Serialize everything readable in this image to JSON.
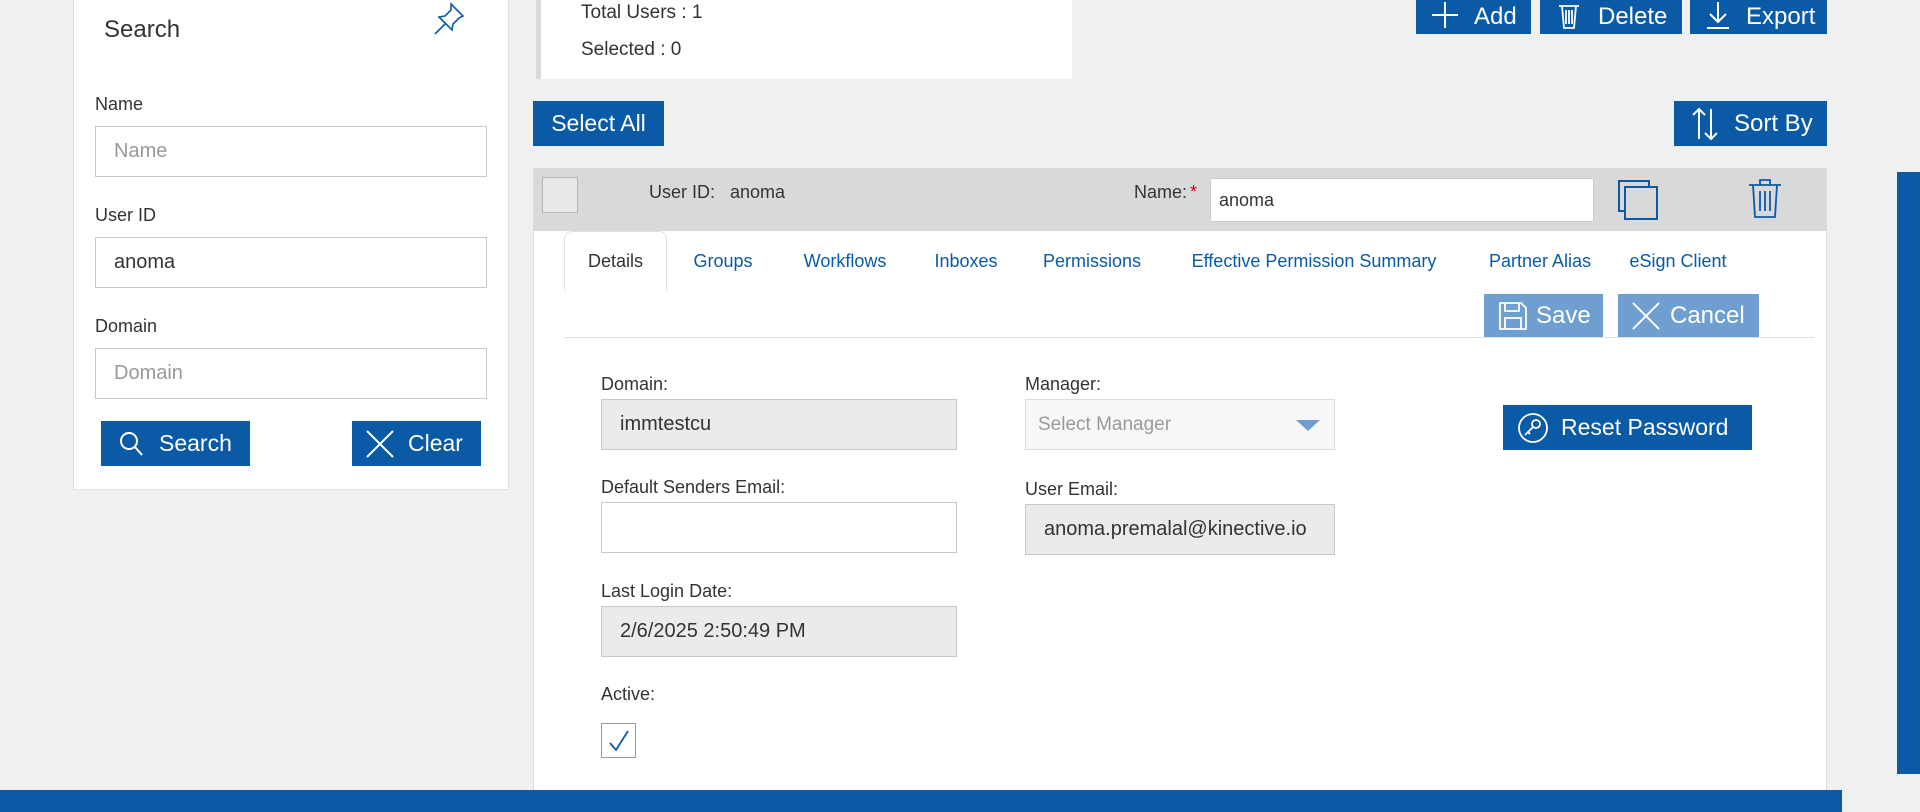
{
  "search_panel": {
    "title": "Search",
    "name_label": "Name",
    "name_placeholder": "Name",
    "name_value": "",
    "userid_label": "User ID",
    "userid_value": "anoma",
    "domain_label": "Domain",
    "domain_placeholder": "Domain",
    "domain_value": "",
    "search_button": "Search",
    "clear_button": "Clear"
  },
  "summary": {
    "total_users": "Total Users : 1",
    "selected": "Selected : 0"
  },
  "toolbar": {
    "add": "Add",
    "delete": "Delete",
    "export": "Export",
    "select_all": "Select All",
    "sort_by": "Sort By"
  },
  "user_row": {
    "userid_label": "User ID:",
    "userid_value": "anoma",
    "name_label": "Name:",
    "required_mark": "*",
    "name_value": "anoma"
  },
  "tabs": [
    {
      "label": "Details"
    },
    {
      "label": "Groups"
    },
    {
      "label": "Workflows"
    },
    {
      "label": "Inboxes"
    },
    {
      "label": "Permissions"
    },
    {
      "label": "Effective Permission Summary"
    },
    {
      "label": "Partner Alias"
    },
    {
      "label": "eSign Client"
    }
  ],
  "details": {
    "save": "Save",
    "cancel": "Cancel",
    "reset_password": "Reset Password",
    "domain_label": "Domain:",
    "domain_value": "immtestcu",
    "manager_label": "Manager:",
    "manager_placeholder": "Select Manager",
    "default_senders_email_label": "Default Senders Email:",
    "default_senders_email_value": "",
    "user_email_label": "User Email:",
    "user_email_value": "anoma.premalal@kinective.io",
    "last_login_label": "Last Login Date:",
    "last_login_value": "2/6/2025 2:50:49 PM",
    "active_label": "Active:",
    "active_checked": true
  },
  "colors": {
    "primary": "#0a5aa6",
    "primary_light": "#6f9fd0",
    "header_gray": "#d9d9d9",
    "required_red": "#d0021b"
  },
  "icons": [
    "pin-icon",
    "search-icon",
    "close-icon",
    "plus-icon",
    "trash-icon",
    "download-icon",
    "sort-icon",
    "copy-icon",
    "save-icon",
    "key-icon",
    "chevron-down-icon",
    "checkmark-icon"
  ]
}
